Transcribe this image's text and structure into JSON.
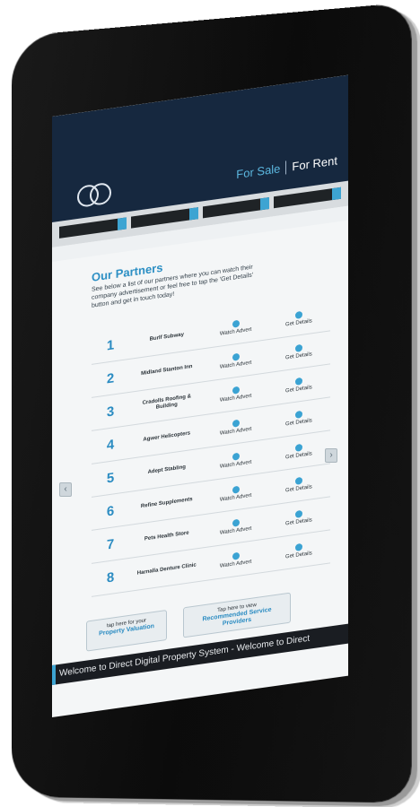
{
  "header": {
    "tab_sale": "For Sale",
    "tab_rent": "For Rent"
  },
  "partners": {
    "title": "Our Partners",
    "intro": "See below a list of our partners where you can watch their company advertisement or feel free to tap the 'Get Details' button and get in touch today!",
    "watch_label": "Watch Advert",
    "details_label": "Get Details",
    "rows": [
      {
        "number": "1",
        "name": "Burlf Subway"
      },
      {
        "number": "2",
        "name": "Midland Stanton Inn"
      },
      {
        "number": "3",
        "name": "Cradolls Roofing & Building"
      },
      {
        "number": "4",
        "name": "Agwer Helicopters"
      },
      {
        "number": "5",
        "name": "Adept Stabling"
      },
      {
        "number": "6",
        "name": "Refine Supplements"
      },
      {
        "number": "7",
        "name": "Pets Health Store"
      },
      {
        "number": "8",
        "name": "Harnalla Denture Clinic"
      }
    ]
  },
  "cta": {
    "valuation_small": "tap here for your",
    "valuation_big": "Property Valuation",
    "providers_small": "Tap here to view",
    "providers_big": "Recommended Service Providers"
  },
  "ticker": "Welcome to Direct Digital Property System - Welcome to Direct",
  "colors": {
    "brand_dark": "#16283f",
    "accent": "#3ba3d3",
    "number_blue": "#2b8cc2"
  }
}
